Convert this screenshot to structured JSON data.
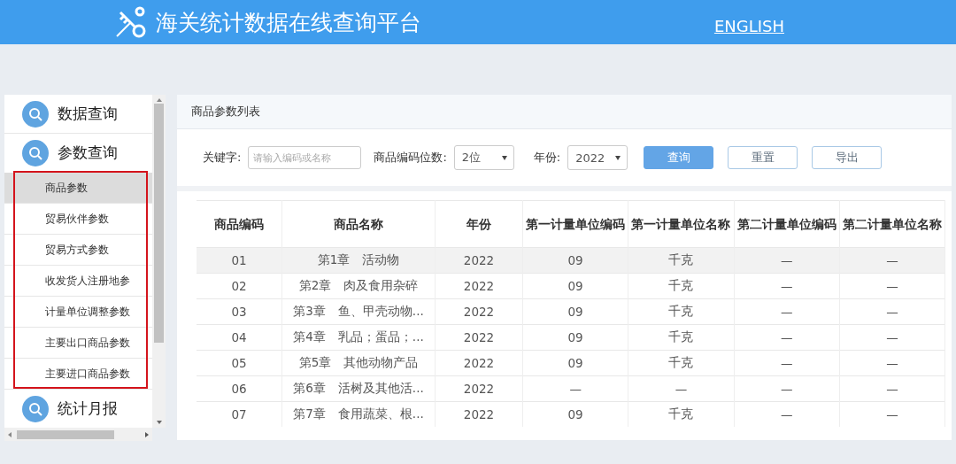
{
  "header": {
    "title": "海关统计数据在线查询平台",
    "language_link": "ENGLISH"
  },
  "sidebar": {
    "items": [
      {
        "label": "数据查询",
        "expanded": false
      },
      {
        "label": "参数查询",
        "expanded": true,
        "children": [
          {
            "label": "商品参数",
            "selected": true
          },
          {
            "label": "贸易伙伴参数",
            "selected": false
          },
          {
            "label": "贸易方式参数",
            "selected": false
          },
          {
            "label": "收发货人注册地参",
            "selected": false
          },
          {
            "label": "计量单位调整参数",
            "selected": false
          },
          {
            "label": "主要出口商品参数",
            "selected": false
          },
          {
            "label": "主要进口商品参数",
            "selected": false
          }
        ]
      },
      {
        "label": "统计月报",
        "expanded": false
      }
    ]
  },
  "main": {
    "title": "商品参数列表",
    "filters": [
      {
        "kind": "text",
        "label": "关键字:",
        "placeholder": "请输入编码或名称"
      },
      {
        "kind": "select",
        "label": "商品编码位数:",
        "value": "2位"
      },
      {
        "kind": "select",
        "label": "年份:",
        "value": "2022"
      }
    ],
    "buttons": [
      {
        "label": "查询",
        "kind": "primary"
      },
      {
        "label": "重置",
        "kind": "plain"
      },
      {
        "label": "导出",
        "kind": "plain"
      }
    ],
    "table": {
      "columns": [
        "商品编码",
        "商品名称",
        "年份",
        "第一计量单位编码",
        "第一计量单位名称",
        "第二计量单位编码",
        "第二计量单位名称"
      ],
      "rows": [
        {
          "selected": true,
          "cells": [
            "01",
            "第1章　活动物",
            "2022",
            "09",
            "千克",
            "—",
            "—"
          ]
        },
        {
          "selected": false,
          "cells": [
            "02",
            "第2章　肉及食用杂碎",
            "2022",
            "09",
            "千克",
            "—",
            "—"
          ]
        },
        {
          "selected": false,
          "cells": [
            "03",
            "第3章　鱼、甲壳动物...",
            "2022",
            "09",
            "千克",
            "—",
            "—"
          ]
        },
        {
          "selected": false,
          "cells": [
            "04",
            "第4章　乳品；蛋品；...",
            "2022",
            "09",
            "千克",
            "—",
            "—"
          ]
        },
        {
          "selected": false,
          "cells": [
            "05",
            "第5章　其他动物产品",
            "2022",
            "09",
            "千克",
            "—",
            "—"
          ]
        },
        {
          "selected": false,
          "cells": [
            "06",
            "第6章　活树及其他活...",
            "2022",
            "—",
            "—",
            "—",
            "—"
          ]
        },
        {
          "selected": false,
          "cells": [
            "07",
            "第7章　食用蔬菜、根...",
            "2022",
            "09",
            "千克",
            "—",
            "—"
          ]
        }
      ]
    }
  }
}
